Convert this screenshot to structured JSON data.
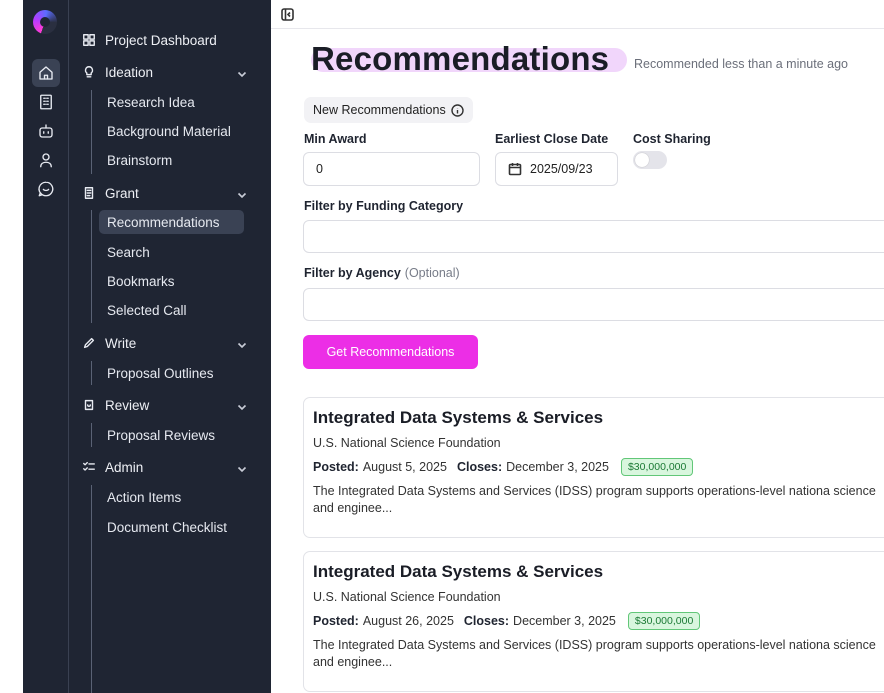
{
  "sidebar": {
    "project_dashboard": "Project Dashboard",
    "groups": {
      "ideation": {
        "label": "Ideation",
        "items": [
          "Research Idea",
          "Background Material",
          "Brainstorm"
        ]
      },
      "grant": {
        "label": "Grant",
        "items": [
          "Recommendations",
          "Search",
          "Bookmarks",
          "Selected Call"
        ]
      },
      "write": {
        "label": "Write",
        "items": [
          "Proposal Outlines"
        ]
      },
      "review": {
        "label": "Review",
        "items": [
          "Proposal Reviews"
        ]
      },
      "admin": {
        "label": "Admin",
        "items": [
          "Action Items",
          "Document Checklist"
        ]
      }
    },
    "active_item": "Recommendations"
  },
  "main": {
    "title": "Recommendations",
    "subtitle": "Recommended less than a minute ago",
    "new_recs_label": "New Recommendations",
    "min_award": {
      "label": "Min Award",
      "value": "0"
    },
    "close_date": {
      "label": "Earliest Close Date",
      "value": "2025/09/23"
    },
    "cost_sharing": {
      "label": "Cost Sharing",
      "enabled": false
    },
    "funding_category": {
      "label": "Filter by Funding Category"
    },
    "agency": {
      "label": "Filter by Agency",
      "optional": "(Optional)"
    },
    "cta_label": "Get Recommendations",
    "results": [
      {
        "title": "Integrated Data Systems & Services",
        "agency": "U.S. National Science Foundation",
        "posted_label": "Posted:",
        "posted": "August 5, 2025",
        "closes_label": "Closes:",
        "closes": "December 3, 2025",
        "award": "$30,000,000",
        "desc": "The Integrated Data Systems and Services (IDSS) program supports operations-level nationa science and enginee..."
      },
      {
        "title": "Integrated Data Systems & Services",
        "agency": "U.S. National Science Foundation",
        "posted_label": "Posted:",
        "posted": "August 26, 2025",
        "closes_label": "Closes:",
        "closes": "December 3, 2025",
        "award": "$30,000,000",
        "desc": "The Integrated Data Systems and Services (IDSS) program supports operations-level nationa science and enginee..."
      }
    ]
  },
  "colors": {
    "sidebar_bg": "#1f2533",
    "accent": "#ec2ee6",
    "title_highlight": "#f1d6fb",
    "award_bg": "#d9f6de"
  }
}
